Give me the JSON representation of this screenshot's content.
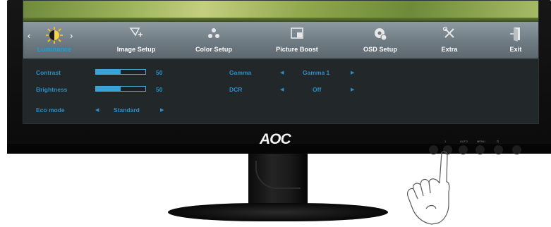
{
  "tabs": [
    {
      "label": "Luminance",
      "icon": "luminance-icon",
      "active": true
    },
    {
      "label": "Image Setup",
      "icon": "image-setup-icon"
    },
    {
      "label": "Color Setup",
      "icon": "color-setup-icon"
    },
    {
      "label": "Picture Boost",
      "icon": "picture-boost-icon"
    },
    {
      "label": "OSD Setup",
      "icon": "osd-setup-icon"
    },
    {
      "label": "Extra",
      "icon": "extra-icon"
    },
    {
      "label": "Exit",
      "icon": "exit-icon"
    }
  ],
  "settings": {
    "contrast": {
      "label": "Contrast",
      "value": "50",
      "level": 0.5
    },
    "brightness": {
      "label": "Brightness",
      "value": "50",
      "level": 0.5
    },
    "eco_mode": {
      "label": "Eco mode",
      "value": "Standard"
    },
    "gamma": {
      "label": "Gamma",
      "value": "Gamma 1"
    },
    "dcr": {
      "label": "DCR",
      "value": "Off"
    }
  },
  "brand": {
    "logo": "AOC"
  },
  "buttons": [
    "1",
    "AUTO",
    "MENU",
    "⏻"
  ],
  "colors": {
    "accent": "#2a8fc6",
    "active_tab": "#1e9fd8",
    "osd_bg": "#22272a"
  }
}
